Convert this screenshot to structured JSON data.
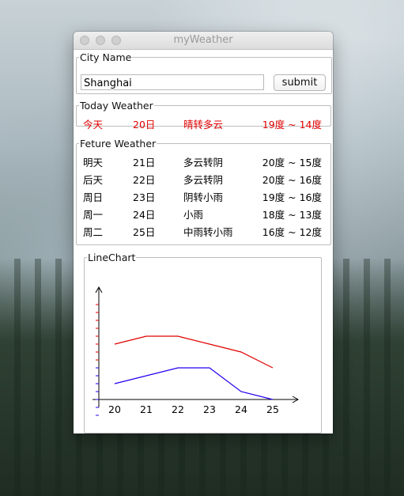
{
  "window": {
    "title": "myWeather"
  },
  "city": {
    "legend": "City Name",
    "value": "Shanghai",
    "submit_label": "submit"
  },
  "today": {
    "legend": "Today Weather",
    "day": "今天",
    "date": "20日",
    "condition": "晴转多云",
    "temp": "19度 ~ 14度"
  },
  "future": {
    "legend": "Feture Weather",
    "rows": [
      {
        "day": "明天",
        "date": "21日",
        "condition": "多云转阴",
        "temp": "20度 ~ 15度"
      },
      {
        "day": "后天",
        "date": "22日",
        "condition": "多云转阴",
        "temp": "20度 ~ 16度"
      },
      {
        "day": "周日",
        "date": "23日",
        "condition": "阴转小雨",
        "temp": "19度 ~ 16度"
      },
      {
        "day": "周一",
        "date": "24日",
        "condition": "小雨",
        "temp": "18度 ~ 13度"
      },
      {
        "day": "周二",
        "date": "25日",
        "condition": "中雨转小雨",
        "temp": "16度 ~ 12度"
      }
    ]
  },
  "chart": {
    "legend": "LineChart",
    "high_color": "#e00000",
    "low_color": "#2200ee"
  },
  "chart_data": {
    "type": "line",
    "x": [
      20,
      21,
      22,
      23,
      24,
      25
    ],
    "series": [
      {
        "values": [
          19,
          20,
          20,
          19,
          18,
          16
        ]
      },
      {
        "values": [
          14,
          15,
          16,
          16,
          13,
          12
        ]
      }
    ],
    "ylim": [
      10,
      24
    ]
  }
}
